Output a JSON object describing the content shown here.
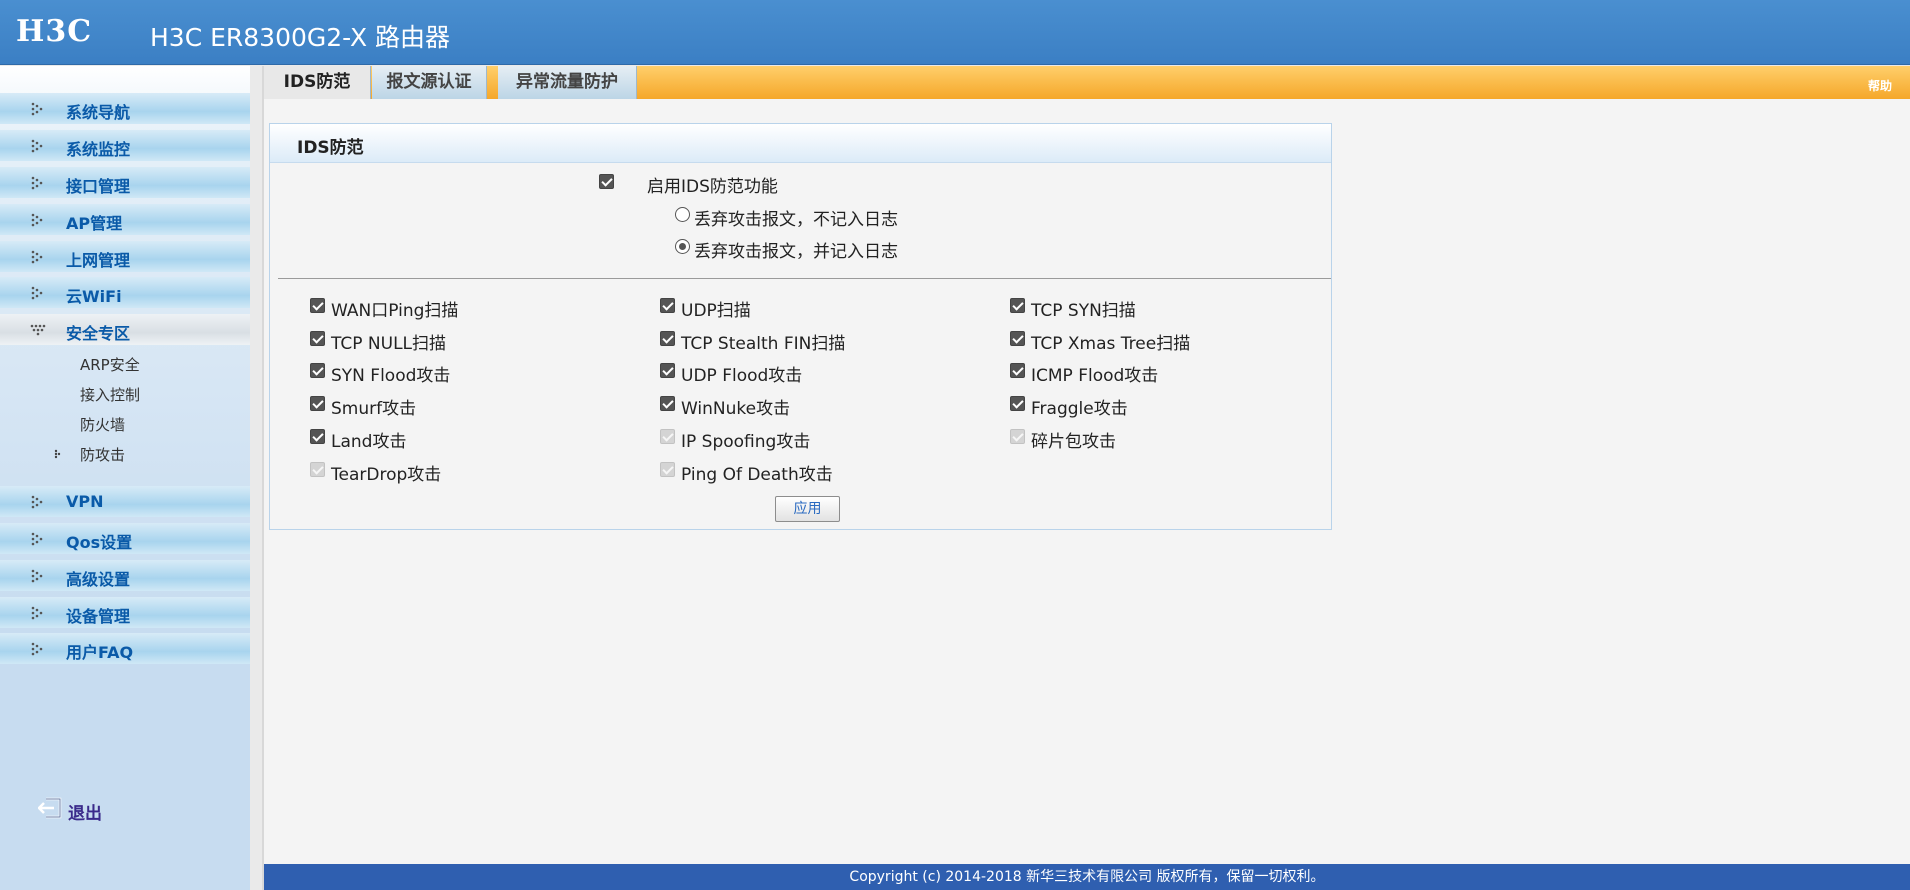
{
  "header": {
    "logo_text": "H3C",
    "title": "H3C ER8300G2-X 路由器"
  },
  "sidebar": {
    "items": [
      {
        "label": "系统导航"
      },
      {
        "label": "系统监控"
      },
      {
        "label": "接口管理"
      },
      {
        "label": "AP管理"
      },
      {
        "label": "上网管理"
      },
      {
        "label": "云WiFi"
      },
      {
        "label": "安全专区"
      },
      {
        "label": "VPN"
      },
      {
        "label": "Qos设置"
      },
      {
        "label": "高级设置"
      },
      {
        "label": "设备管理"
      },
      {
        "label": "用户FAQ"
      }
    ],
    "sub_items": [
      {
        "label": "ARP安全"
      },
      {
        "label": "接入控制"
      },
      {
        "label": "防火墙"
      },
      {
        "label": "防攻击"
      }
    ],
    "logout_label": "退出"
  },
  "tabs": [
    {
      "label": "IDS防范"
    },
    {
      "label": "报文源认证"
    },
    {
      "label": "异常流量防护"
    }
  ],
  "help_label": "帮助",
  "panel": {
    "title": "IDS防范",
    "enable_label": "启用IDS防范功能",
    "mode_options": [
      {
        "label": "丢弃攻击报文，不记入日志",
        "selected": false
      },
      {
        "label": "丢弃攻击报文，并记入日志",
        "selected": true
      }
    ],
    "options": [
      {
        "label": "WAN口Ping扫描",
        "state": "checked"
      },
      {
        "label": "UDP扫描",
        "state": "checked"
      },
      {
        "label": "TCP SYN扫描",
        "state": "checked"
      },
      {
        "label": "TCP NULL扫描",
        "state": "checked"
      },
      {
        "label": "TCP Stealth FIN扫描",
        "state": "checked"
      },
      {
        "label": "TCP Xmas Tree扫描",
        "state": "checked"
      },
      {
        "label": "SYN Flood攻击",
        "state": "checked"
      },
      {
        "label": "UDP Flood攻击",
        "state": "checked"
      },
      {
        "label": "ICMP Flood攻击",
        "state": "checked"
      },
      {
        "label": "Smurf攻击",
        "state": "checked"
      },
      {
        "label": "WinNuke攻击",
        "state": "checked"
      },
      {
        "label": "Fraggle攻击",
        "state": "checked"
      },
      {
        "label": "Land攻击",
        "state": "checked"
      },
      {
        "label": "IP Spoofing攻击",
        "state": "disabled"
      },
      {
        "label": "碎片包攻击",
        "state": "disabled"
      },
      {
        "label": "TearDrop攻击",
        "state": "disabled"
      },
      {
        "label": "Ping Of Death攻击",
        "state": "disabled"
      }
    ],
    "apply_label": "应用"
  },
  "footer": {
    "copyright": "Copyright (c) 2014-2018 新华三技术有限公司 版权所有，保留一切权利。"
  },
  "colors": {
    "header_blue": "#3b7fc4",
    "tabbar_orange": "#f5a72a",
    "nav_text": "#0a5aa8",
    "footer_blue": "#2f5fb0"
  }
}
